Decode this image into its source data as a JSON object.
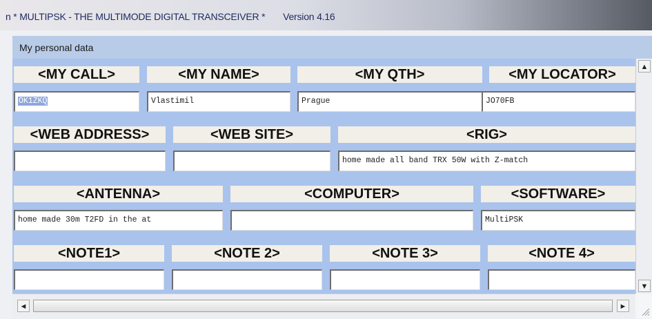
{
  "window": {
    "title": "n  * MULTIPSK - THE MULTIMODE DIGITAL TRANSCEIVER *",
    "version": "Version 4.16"
  },
  "section": {
    "title": "My personal data"
  },
  "row1": {
    "call_label": "<MY CALL>",
    "call_value": "OK1ZKQ",
    "name_label": "<MY NAME>",
    "name_value": "Vlastimil",
    "qth_label": "<MY QTH>",
    "qth_value": "Prague",
    "locator_label": "<MY LOCATOR>",
    "locator_value": "JO70FB"
  },
  "row2": {
    "web_address_label": "<WEB ADDRESS>",
    "web_address_value": "",
    "web_site_label": "<WEB SITE>",
    "web_site_value": "",
    "rig_label": "<RIG>",
    "rig_value": "home made all band TRX 50W with Z-match"
  },
  "row3": {
    "antenna_label": "<ANTENNA>",
    "antenna_value": "home made 30m T2FD in the at",
    "computer_label": "<COMPUTER>",
    "computer_value": "",
    "software_label": "<SOFTWARE>",
    "software_value": "MultiPSK"
  },
  "row4": {
    "note1_label": "<NOTE1>",
    "note1_value": "",
    "note2_label": "<NOTE 2>",
    "note2_value": "",
    "note3_label": "<NOTE 3>",
    "note3_value": "",
    "note4_label": "<NOTE 4>",
    "note4_value": ""
  },
  "scrollbars": {
    "up_icon": "▲",
    "down_icon": "▼",
    "left_icon": "◄",
    "right_icon": "►"
  },
  "colors": {
    "panel_background": "#a9c3ec",
    "label_background": "#f1efe7",
    "selection": "#8ea7dd"
  }
}
